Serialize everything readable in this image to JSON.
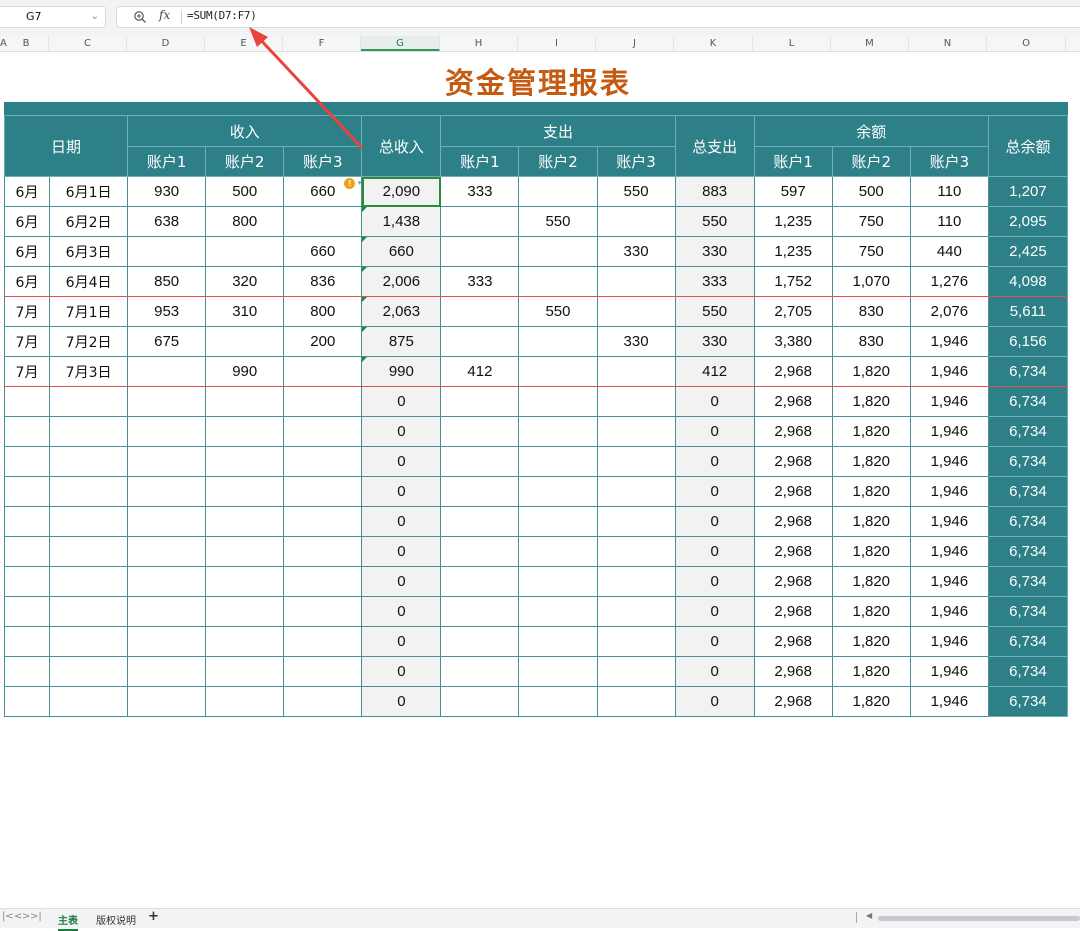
{
  "formula_bar": {
    "cell_ref": "G7",
    "formula": "=SUM(D7:F7)",
    "fx_label": "fx",
    "zoom_icon": "zoom-in-icon",
    "chevron_icon": "chevron-down-icon"
  },
  "columns": [
    "A",
    "B",
    "C",
    "D",
    "E",
    "F",
    "G",
    "H",
    "I",
    "J",
    "K",
    "L",
    "M",
    "N",
    "O"
  ],
  "active_column": "G",
  "title": "资金管理报表",
  "colors": {
    "header_teal": "#2d7f88",
    "title_orange": "#c55a11",
    "selection_green": "#2e8b3e",
    "month_divider": "#e05252",
    "annotation_red": "#e8443a"
  },
  "headers": {
    "date": "日期",
    "income_group": "收入",
    "total_income": "总收入",
    "expense_group": "支出",
    "total_expense": "总支出",
    "balance_group": "余额",
    "total_balance": "总余额",
    "acc1": "账户1",
    "acc2": "账户2",
    "acc3": "账户3"
  },
  "rows": [
    {
      "month": "6月",
      "date": "6月1日",
      "in1": "930",
      "in2": "500",
      "in3": "660",
      "total_in": "2,090",
      "out1": "333",
      "out2": "",
      "out3": "550",
      "total_out": "883",
      "bal1": "597",
      "bal2": "500",
      "bal3": "110",
      "total_bal": "1,207"
    },
    {
      "month": "6月",
      "date": "6月2日",
      "in1": "638",
      "in2": "800",
      "in3": "",
      "total_in": "1,438",
      "out1": "",
      "out2": "550",
      "out3": "",
      "total_out": "550",
      "bal1": "1,235",
      "bal2": "750",
      "bal3": "110",
      "total_bal": "2,095"
    },
    {
      "month": "6月",
      "date": "6月3日",
      "in1": "",
      "in2": "",
      "in3": "660",
      "total_in": "660",
      "out1": "",
      "out2": "",
      "out3": "330",
      "total_out": "330",
      "bal1": "1,235",
      "bal2": "750",
      "bal3": "440",
      "total_bal": "2,425"
    },
    {
      "month": "6月",
      "date": "6月4日",
      "in1": "850",
      "in2": "320",
      "in3": "836",
      "total_in": "2,006",
      "out1": "333",
      "out2": "",
      "out3": "",
      "total_out": "333",
      "bal1": "1,752",
      "bal2": "1,070",
      "bal3": "1,276",
      "total_bal": "4,098"
    },
    {
      "month": "7月",
      "date": "7月1日",
      "in1": "953",
      "in2": "310",
      "in3": "800",
      "total_in": "2,063",
      "out1": "",
      "out2": "550",
      "out3": "",
      "total_out": "550",
      "bal1": "2,705",
      "bal2": "830",
      "bal3": "2,076",
      "total_bal": "5,611"
    },
    {
      "month": "7月",
      "date": "7月2日",
      "in1": "675",
      "in2": "",
      "in3": "200",
      "total_in": "875",
      "out1": "",
      "out2": "",
      "out3": "330",
      "total_out": "330",
      "bal1": "3,380",
      "bal2": "830",
      "bal3": "1,946",
      "total_bal": "6,156"
    },
    {
      "month": "7月",
      "date": "7月3日",
      "in1": "",
      "in2": "990",
      "in3": "",
      "total_in": "990",
      "out1": "412",
      "out2": "",
      "out3": "",
      "total_out": "412",
      "bal1": "2,968",
      "bal2": "1,820",
      "bal3": "1,946",
      "total_bal": "6,734"
    },
    {
      "month": "",
      "date": "",
      "in1": "",
      "in2": "",
      "in3": "",
      "total_in": "0",
      "out1": "",
      "out2": "",
      "out3": "",
      "total_out": "0",
      "bal1": "2,968",
      "bal2": "1,820",
      "bal3": "1,946",
      "total_bal": "6,734"
    },
    {
      "month": "",
      "date": "",
      "in1": "",
      "in2": "",
      "in3": "",
      "total_in": "0",
      "out1": "",
      "out2": "",
      "out3": "",
      "total_out": "0",
      "bal1": "2,968",
      "bal2": "1,820",
      "bal3": "1,946",
      "total_bal": "6,734"
    },
    {
      "month": "",
      "date": "",
      "in1": "",
      "in2": "",
      "in3": "",
      "total_in": "0",
      "out1": "",
      "out2": "",
      "out3": "",
      "total_out": "0",
      "bal1": "2,968",
      "bal2": "1,820",
      "bal3": "1,946",
      "total_bal": "6,734"
    },
    {
      "month": "",
      "date": "",
      "in1": "",
      "in2": "",
      "in3": "",
      "total_in": "0",
      "out1": "",
      "out2": "",
      "out3": "",
      "total_out": "0",
      "bal1": "2,968",
      "bal2": "1,820",
      "bal3": "1,946",
      "total_bal": "6,734"
    },
    {
      "month": "",
      "date": "",
      "in1": "",
      "in2": "",
      "in3": "",
      "total_in": "0",
      "out1": "",
      "out2": "",
      "out3": "",
      "total_out": "0",
      "bal1": "2,968",
      "bal2": "1,820",
      "bal3": "1,946",
      "total_bal": "6,734"
    },
    {
      "month": "",
      "date": "",
      "in1": "",
      "in2": "",
      "in3": "",
      "total_in": "0",
      "out1": "",
      "out2": "",
      "out3": "",
      "total_out": "0",
      "bal1": "2,968",
      "bal2": "1,820",
      "bal3": "1,946",
      "total_bal": "6,734"
    },
    {
      "month": "",
      "date": "",
      "in1": "",
      "in2": "",
      "in3": "",
      "total_in": "0",
      "out1": "",
      "out2": "",
      "out3": "",
      "total_out": "0",
      "bal1": "2,968",
      "bal2": "1,820",
      "bal3": "1,946",
      "total_bal": "6,734"
    },
    {
      "month": "",
      "date": "",
      "in1": "",
      "in2": "",
      "in3": "",
      "total_in": "0",
      "out1": "",
      "out2": "",
      "out3": "",
      "total_out": "0",
      "bal1": "2,968",
      "bal2": "1,820",
      "bal3": "1,946",
      "total_bal": "6,734"
    },
    {
      "month": "",
      "date": "",
      "in1": "",
      "in2": "",
      "in3": "",
      "total_in": "0",
      "out1": "",
      "out2": "",
      "out3": "",
      "total_out": "0",
      "bal1": "2,968",
      "bal2": "1,820",
      "bal3": "1,946",
      "total_bal": "6,734"
    },
    {
      "month": "",
      "date": "",
      "in1": "",
      "in2": "",
      "in3": "",
      "total_in": "0",
      "out1": "",
      "out2": "",
      "out3": "",
      "total_out": "0",
      "bal1": "2,968",
      "bal2": "1,820",
      "bal3": "1,946",
      "total_bal": "6,734"
    },
    {
      "month": "",
      "date": "",
      "in1": "",
      "in2": "",
      "in3": "",
      "total_in": "0",
      "out1": "",
      "out2": "",
      "out3": "",
      "total_out": "0",
      "bal1": "2,968",
      "bal2": "1,820",
      "bal3": "1,946",
      "total_bal": "6,734"
    }
  ],
  "selected_cell": {
    "row": 0,
    "col": "total_in"
  },
  "warning_icon": "warning-icon",
  "tabs": {
    "nav_first": "|<",
    "nav_prev": "<",
    "nav_next": ">",
    "nav_last": ">|",
    "sheet1": "主表",
    "sheet2": "版权说明",
    "add": "+"
  }
}
